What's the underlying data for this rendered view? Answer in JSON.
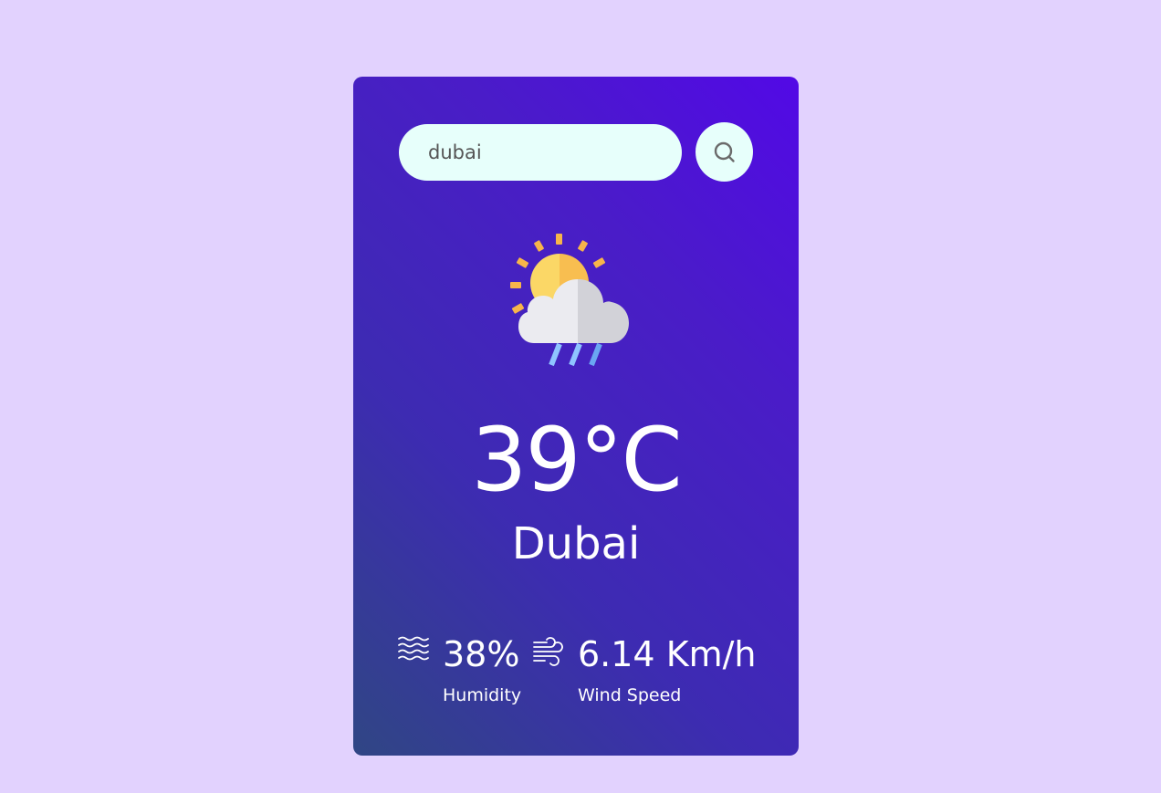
{
  "search": {
    "value": "dubai",
    "placeholder": ""
  },
  "weather": {
    "icon": "rain-sun-cloud-icon",
    "temperature": "39°C",
    "city": "Dubai"
  },
  "details": {
    "humidity": {
      "icon": "humidity-waves-icon",
      "value": "38%",
      "label": "Humidity"
    },
    "wind": {
      "icon": "wind-icon",
      "value": "6.14 Km/h",
      "label": "Wind Speed"
    }
  },
  "colors": {
    "page_background": "#e2d2fe",
    "card_gradient_start": "#5209e6",
    "card_gradient_end": "#304684",
    "input_background": "#e7fffb",
    "text": "#ffffff"
  }
}
